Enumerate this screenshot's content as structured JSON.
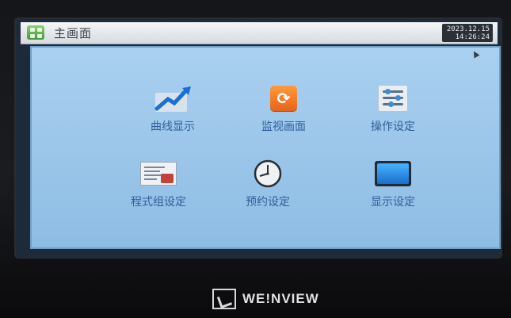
{
  "window": {
    "title": "主画面"
  },
  "clock": {
    "date": "2023.12.15",
    "time": "14:26:24"
  },
  "menu": {
    "items": [
      {
        "label": "曲线显示",
        "icon": "trend-curve-icon"
      },
      {
        "label": "监视画面",
        "icon": "monitor-refresh-icon"
      },
      {
        "label": "操作设定",
        "icon": "sliders-settings-icon"
      },
      {
        "label": "程式组设定",
        "icon": "program-group-icon"
      },
      {
        "label": "预约设定",
        "icon": "clock-icon"
      },
      {
        "label": "显示设定",
        "icon": "display-icon"
      }
    ]
  },
  "colors": {
    "panel": "#9cc6ea",
    "label": "#2f5f9a",
    "titlebar": "#e3e6ea"
  },
  "brand": {
    "name": "WE!NVIEW"
  }
}
